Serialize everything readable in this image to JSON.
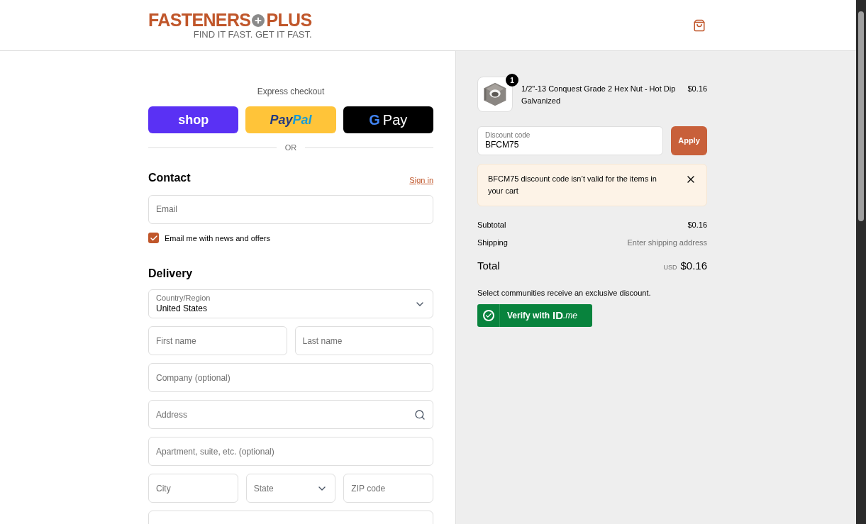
{
  "header": {
    "brand": "FASTENERS",
    "brand_plus": "PLUS",
    "tagline": "FIND IT FAST. GET IT FAST."
  },
  "express": {
    "title": "Express checkout",
    "buttons": [
      {
        "kind": "shop",
        "label": "shop"
      },
      {
        "kind": "paypal",
        "label": "Pay",
        "label2": "Pal"
      },
      {
        "kind": "gpay",
        "label": "G",
        "label2": "Pay"
      }
    ],
    "divider": "OR"
  },
  "contact": {
    "title": "Contact",
    "link": "Sign in",
    "email": {
      "placeholder": "Email"
    },
    "newsletter": {
      "label": "Email me with news and offers",
      "checked": true
    }
  },
  "delivery": {
    "title": "Delivery",
    "rows": [
      [
        {
          "kind": "select",
          "label": "Country/Region",
          "value": "United States"
        }
      ],
      [
        {
          "kind": "text",
          "placeholder": "First name"
        },
        {
          "kind": "text",
          "placeholder": "Last name"
        }
      ],
      [
        {
          "kind": "text",
          "placeholder": "Company (optional)"
        }
      ],
      [
        {
          "kind": "search",
          "placeholder": "Address"
        }
      ],
      [
        {
          "kind": "text",
          "placeholder": "Apartment, suite, etc. (optional)"
        }
      ],
      [
        {
          "kind": "text",
          "placeholder": "City"
        },
        {
          "kind": "select",
          "placeholder": "State"
        },
        {
          "kind": "text",
          "placeholder": "ZIP code"
        }
      ],
      [
        {
          "kind": "text"
        }
      ]
    ]
  },
  "order": {
    "items": [
      {
        "quantity": "1",
        "name": "1/2\"-13 Conquest Grade 2 Hex Nut - Hot Dip Galvanized",
        "price": "$0.16"
      }
    ],
    "discount": {
      "label": "Discount code",
      "value": "BFCM75",
      "button": "Apply"
    },
    "error": "BFCM75 discount code isn’t valid for the items in your cart",
    "subtotal": {
      "label": "Subtotal",
      "value": "$0.16"
    },
    "shipping": {
      "label": "Shipping",
      "value": "Enter shipping address"
    },
    "total": {
      "label": "Total",
      "currency": "USD",
      "value": "$0.16"
    },
    "promo": "Select communities receive an exclusive discount.",
    "verify": {
      "label": "Verify with",
      "brand": "ID",
      "brand2": ".me"
    }
  }
}
